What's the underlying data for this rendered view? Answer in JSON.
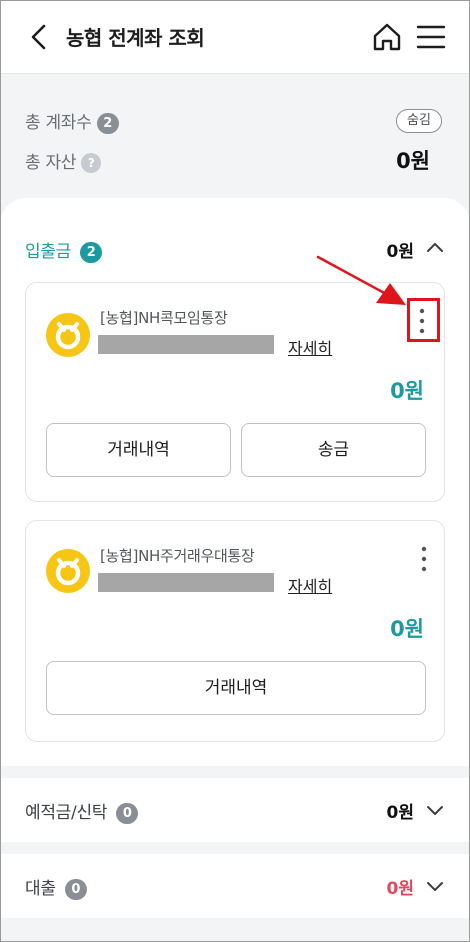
{
  "header": {
    "title": "농협 전계좌 조회"
  },
  "summary": {
    "account_count_label": "총 계좌수",
    "account_count": "2",
    "total_asset_label": "총 자산",
    "help_mark": "?",
    "hide_label": "숨김",
    "total_asset": "0원"
  },
  "deposit_section": {
    "title": "입출금",
    "count": "2",
    "amount": "0원",
    "expanded": true,
    "accounts": [
      {
        "name": "[농협]NH콕모임통장",
        "detail_label": "자세히",
        "balance": "0원",
        "buttons": [
          "거래내역",
          "송금"
        ]
      },
      {
        "name": "[농협]NH주거래우대통장",
        "detail_label": "자세히",
        "balance": "0원",
        "buttons": [
          "거래내역"
        ]
      }
    ]
  },
  "savings_section": {
    "title": "예적금/신탁",
    "count": "0",
    "amount": "0원"
  },
  "loan_section": {
    "title": "대출",
    "count": "0",
    "amount": "0원"
  },
  "colors": {
    "accent": "#1b9aa0",
    "loan_amount": "#e2495a",
    "highlight": "#e0151b",
    "bank_logo": "#f7c514"
  },
  "icons": {
    "back": "chevron-left-icon",
    "home": "home-icon",
    "menu": "hamburger-menu-icon",
    "more": "kebab-menu-icon",
    "bank": "nh-bank-logo-icon"
  }
}
